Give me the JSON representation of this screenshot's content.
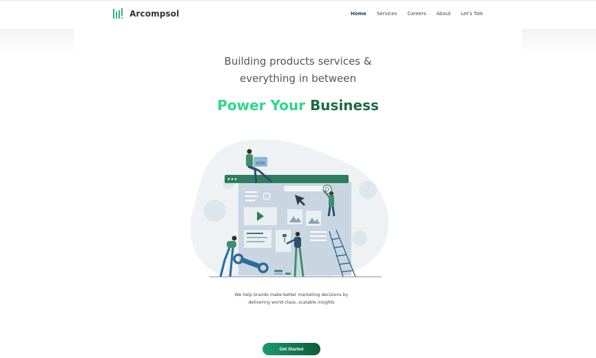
{
  "brand": {
    "name": "Arcompsol",
    "icon": "bars-logo-icon",
    "color": "#2fb37a"
  },
  "nav": {
    "items": [
      {
        "label": "Home",
        "active": true
      },
      {
        "label": "Services",
        "active": false
      },
      {
        "label": "Careers",
        "active": false
      },
      {
        "label": "About",
        "active": false
      },
      {
        "label": "Let's Talk",
        "active": false
      }
    ]
  },
  "hero": {
    "headline_line1": "Building products services &",
    "headline_line2": "everything in between",
    "power_part1": "Power Your",
    "power_part2": "Business",
    "illustration_code_label": "</>",
    "description": "We help brands make better marketing decisions by delivering world-class, scalable insights",
    "cta_label": "Get Started"
  },
  "colors": {
    "accent_light": "#2fd88a",
    "accent_dark": "#1a6b45",
    "nav_active": "#1f3a5f",
    "cta_start": "#1a9a6b",
    "cta_end": "#0f5a3b"
  }
}
